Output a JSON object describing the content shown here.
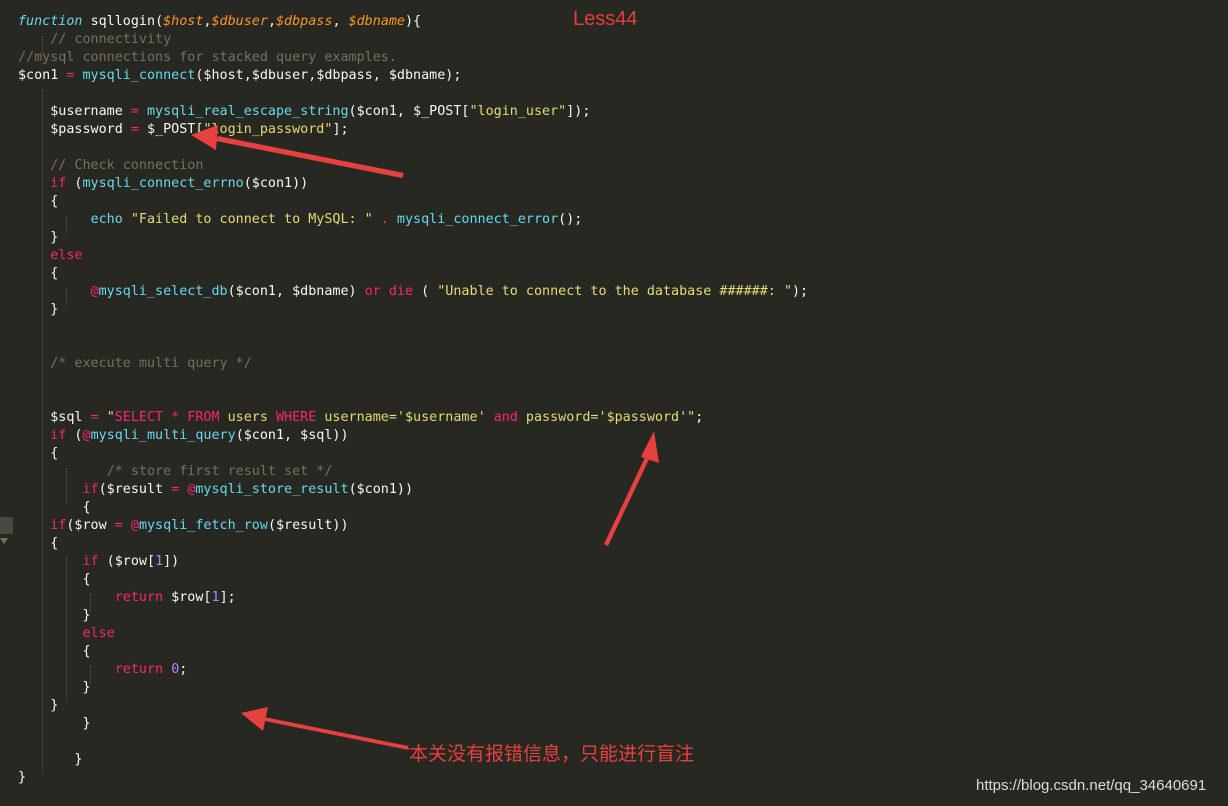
{
  "title_label": "Less44",
  "annotation": "本关没有报错信息，只能进行盲注",
  "watermark": "https://blog.csdn.net/qq_34640691",
  "colors": {
    "background": "#272822",
    "text": "#f8f8f2",
    "keyword": "#f92672",
    "function": "#66d9ef",
    "string": "#e6db74",
    "param": "#fd971f",
    "comment": "#75715e",
    "number": "#ae81ff",
    "annotation_red": "#e8403e"
  },
  "code_lines": [
    [
      [
        "function",
        "fn"
      ],
      [
        " "
      ],
      [
        "sqllogin",
        "name"
      ],
      [
        "("
      ],
      [
        "$host",
        "param"
      ],
      [
        ","
      ],
      [
        "$dbuser",
        "param"
      ],
      [
        ","
      ],
      [
        "$dbpass",
        "param"
      ],
      [
        ", "
      ],
      [
        "$dbname",
        "param"
      ],
      [
        "){"
      ]
    ],
    [
      [
        "    "
      ],
      [
        "// connectivity",
        "c"
      ]
    ],
    [
      [
        "//mysql connections for stacked query examples.",
        "c"
      ]
    ],
    [
      [
        "$con1 "
      ],
      [
        "=",
        "k"
      ],
      [
        " "
      ],
      [
        "mysqli_connect",
        "f"
      ],
      [
        "($host,$dbuser,$dbpass, $dbname);"
      ]
    ],
    [
      [
        ""
      ]
    ],
    [
      [
        "    $username "
      ],
      [
        "=",
        "k"
      ],
      [
        " "
      ],
      [
        "mysqli_real_escape_string",
        "f"
      ],
      [
        "($con1, $_POST["
      ],
      [
        "\"login_user\"",
        "s"
      ],
      [
        "]);"
      ]
    ],
    [
      [
        "    $password "
      ],
      [
        "=",
        "k"
      ],
      [
        " $_POST["
      ],
      [
        "\"login_password\"",
        "s"
      ],
      [
        "];"
      ]
    ],
    [
      [
        ""
      ]
    ],
    [
      [
        "    "
      ],
      [
        "// Check connection",
        "c"
      ]
    ],
    [
      [
        "    "
      ],
      [
        "if",
        "k"
      ],
      [
        " ("
      ],
      [
        "mysqli_connect_errno",
        "f"
      ],
      [
        "($con1))"
      ]
    ],
    [
      [
        "    {"
      ]
    ],
    [
      [
        "         "
      ],
      [
        "echo",
        "f"
      ],
      [
        " "
      ],
      [
        "\"Failed to connect to MySQL: \"",
        "s"
      ],
      [
        " "
      ],
      [
        ".",
        "k"
      ],
      [
        " "
      ],
      [
        "mysqli_connect_error",
        "f"
      ],
      [
        "();"
      ]
    ],
    [
      [
        "    }"
      ]
    ],
    [
      [
        "    "
      ],
      [
        "else",
        "k"
      ]
    ],
    [
      [
        "    {"
      ]
    ],
    [
      [
        "         "
      ],
      [
        "@",
        "k"
      ],
      [
        "mysqli_select_db",
        "f"
      ],
      [
        "($con1, $dbname) "
      ],
      [
        "or",
        "k"
      ],
      [
        " "
      ],
      [
        "die",
        "k"
      ],
      [
        " ( "
      ],
      [
        "\"Unable to connect to the database ######: \"",
        "s"
      ],
      [
        ");"
      ]
    ],
    [
      [
        "    }"
      ]
    ],
    [
      [
        ""
      ]
    ],
    [
      [
        ""
      ]
    ],
    [
      [
        "    "
      ],
      [
        "/* execute multi query */",
        "c"
      ]
    ],
    [
      [
        ""
      ]
    ],
    [
      [
        ""
      ]
    ],
    [
      [
        "    $sql "
      ],
      [
        "=",
        "k"
      ],
      [
        " "
      ],
      [
        "\"",
        "s"
      ],
      [
        "SELECT * FROM",
        "k"
      ],
      [
        " users ",
        "s"
      ],
      [
        "WHERE",
        "k"
      ],
      [
        " username='",
        "s"
      ],
      [
        "$username",
        "s"
      ],
      [
        "' ",
        "s"
      ],
      [
        "and",
        "k"
      ],
      [
        " password='",
        "s"
      ],
      [
        "$password",
        "s"
      ],
      [
        "'\"",
        "s"
      ],
      [
        ";"
      ]
    ],
    [
      [
        "    "
      ],
      [
        "if",
        "k"
      ],
      [
        " ("
      ],
      [
        "@",
        "k"
      ],
      [
        "mysqli_multi_query",
        "f"
      ],
      [
        "($con1, $sql))"
      ]
    ],
    [
      [
        "    {"
      ]
    ],
    [
      [
        "           "
      ],
      [
        "/* store first result set */",
        "c"
      ]
    ],
    [
      [
        "        "
      ],
      [
        "if",
        "k"
      ],
      [
        "($result "
      ],
      [
        "=",
        "k"
      ],
      [
        " "
      ],
      [
        "@",
        "k"
      ],
      [
        "mysqli_store_result",
        "f"
      ],
      [
        "($con1))"
      ]
    ],
    [
      [
        "        {"
      ]
    ],
    [
      [
        "    "
      ],
      [
        "if",
        "k"
      ],
      [
        "($row "
      ],
      [
        "=",
        "k"
      ],
      [
        " "
      ],
      [
        "@",
        "k"
      ],
      [
        "mysqli_fetch_row",
        "f"
      ],
      [
        "($result))"
      ]
    ],
    [
      [
        "    {"
      ]
    ],
    [
      [
        "        "
      ],
      [
        "if",
        "k"
      ],
      [
        " ($row["
      ],
      [
        "1",
        "n"
      ],
      [
        "])"
      ]
    ],
    [
      [
        "        {"
      ]
    ],
    [
      [
        "            "
      ],
      [
        "return",
        "k"
      ],
      [
        " $row["
      ],
      [
        "1",
        "n"
      ],
      [
        "];"
      ]
    ],
    [
      [
        "        }"
      ]
    ],
    [
      [
        "        "
      ],
      [
        "else",
        "k"
      ]
    ],
    [
      [
        "        {"
      ]
    ],
    [
      [
        "            "
      ],
      [
        "return",
        "k"
      ],
      [
        " "
      ],
      [
        "0",
        "n"
      ],
      [
        ";"
      ]
    ],
    [
      [
        "        }"
      ]
    ],
    [
      [
        "    }"
      ]
    ],
    [
      [
        "        }"
      ]
    ],
    [
      [
        ""
      ]
    ],
    [
      [
        "       }"
      ]
    ],
    [
      [
        "}"
      ]
    ]
  ]
}
